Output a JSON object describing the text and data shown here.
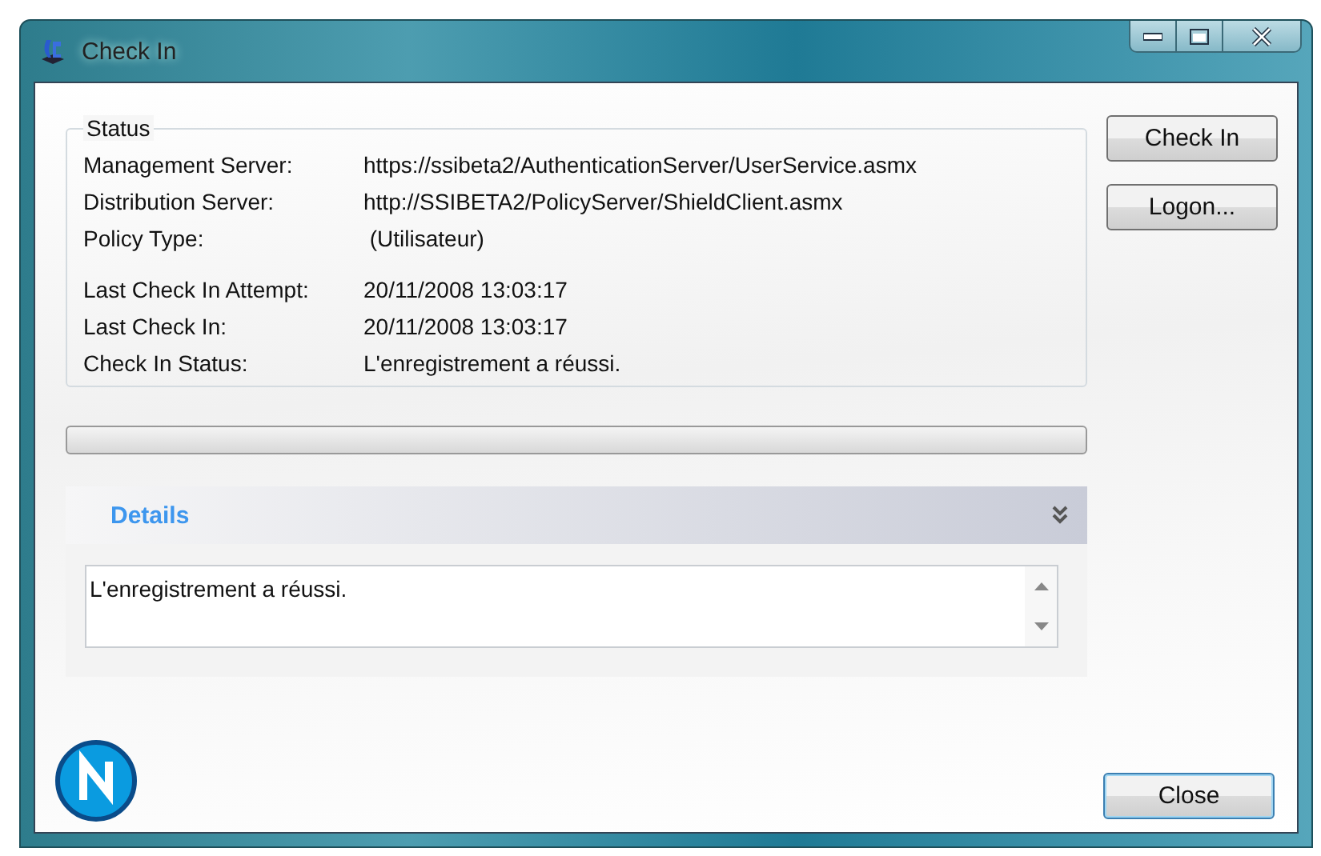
{
  "window": {
    "title": "Check In"
  },
  "status": {
    "title": "Status",
    "row_groups": [
      [
        {
          "label": "Management Server:",
          "value": "https://ssibeta2/AuthenticationServer/UserService.asmx"
        },
        {
          "label": "Distribution Server:",
          "value": "http://SSIBETA2/PolicyServer/ShieldClient.asmx"
        },
        {
          "label": "Policy Type:",
          "value": " (Utilisateur)"
        }
      ],
      [
        {
          "label": "Last Check In Attempt:",
          "value": "20/11/2008 13:03:17"
        },
        {
          "label": "Last Check In:",
          "value": "20/11/2008 13:03:17"
        },
        {
          "label": "Check In Status:",
          "value": "L'enregistrement a réussi."
        }
      ]
    ]
  },
  "progress": {
    "level": 0
  },
  "side_buttons": [
    "Check In",
    "Logon..."
  ],
  "details": {
    "title": "Details",
    "text": "L'enregistrement a réussi."
  },
  "close_button": "Close"
}
